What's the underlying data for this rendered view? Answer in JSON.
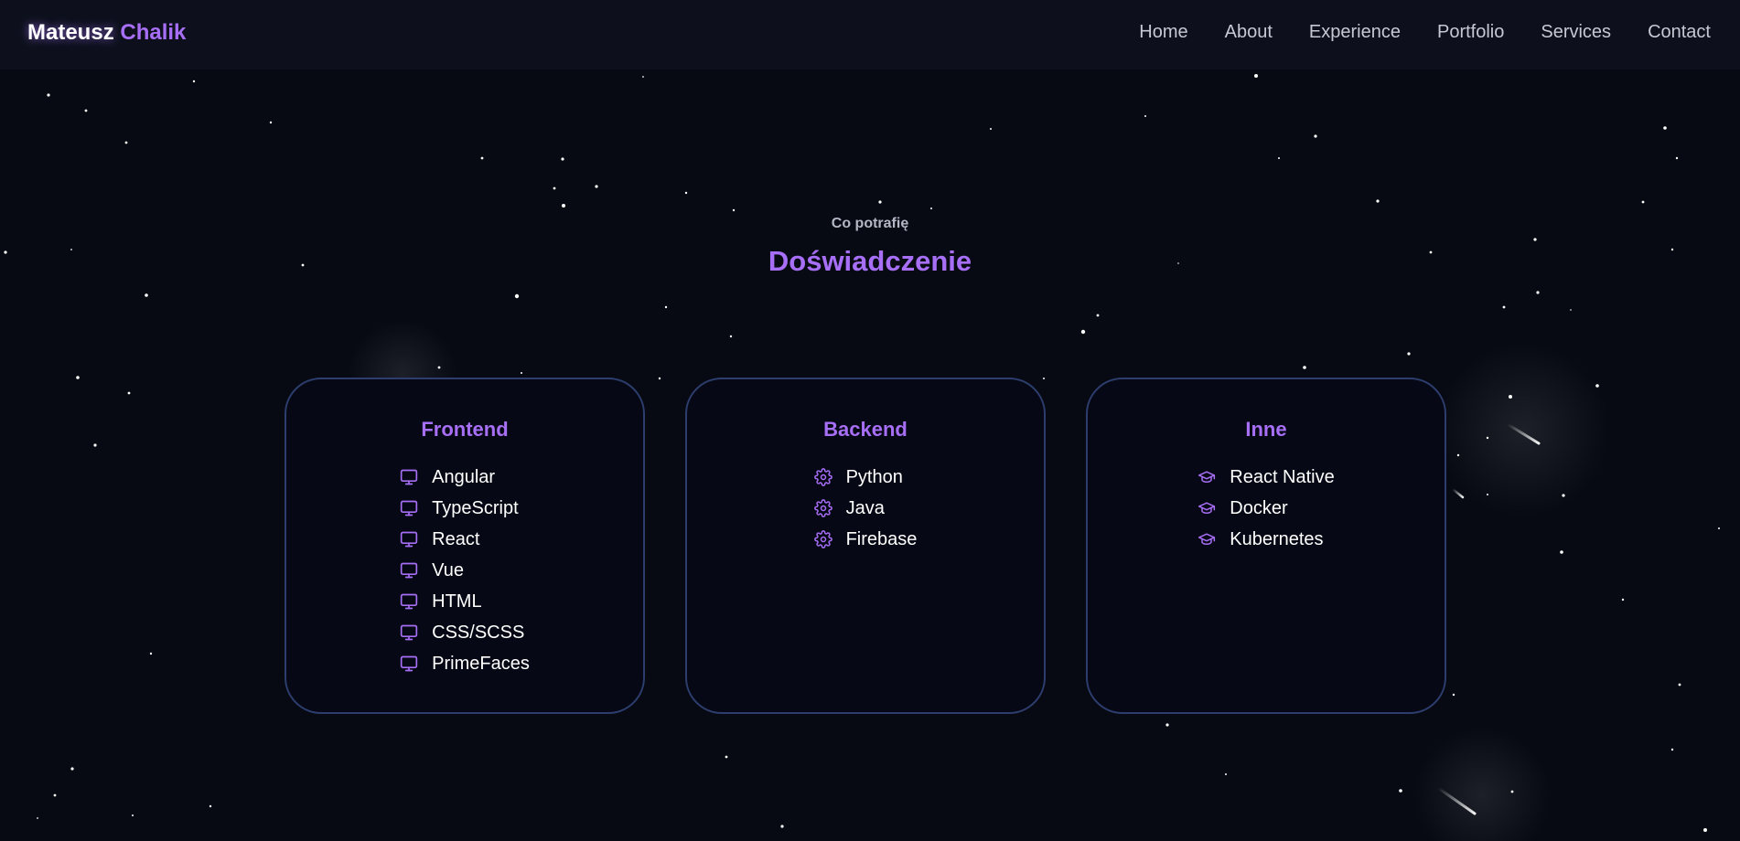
{
  "brand": {
    "first": "Mateusz",
    "last": "Chalik"
  },
  "nav": [
    "Home",
    "About",
    "Experience",
    "Portfolio",
    "Services",
    "Contact"
  ],
  "section": {
    "eyebrow": "Co potrafię",
    "title": "Doświadczenie"
  },
  "colors": {
    "accent": "#a76ef6",
    "background": "#070a13",
    "card_border": "#2d3e6e"
  },
  "cards": [
    {
      "title": "Frontend",
      "icon": "monitor-icon",
      "items": [
        "Angular",
        "TypeScript",
        "React",
        "Vue",
        "HTML",
        "CSS/SCSS",
        "PrimeFaces"
      ]
    },
    {
      "title": "Backend",
      "icon": "gear-icon",
      "items": [
        "Python",
        "Java",
        "Firebase"
      ]
    },
    {
      "title": "Inne",
      "icon": "graduation-cap-icon",
      "items": [
        "React Native",
        "Docker",
        "Kubernetes"
      ]
    }
  ]
}
